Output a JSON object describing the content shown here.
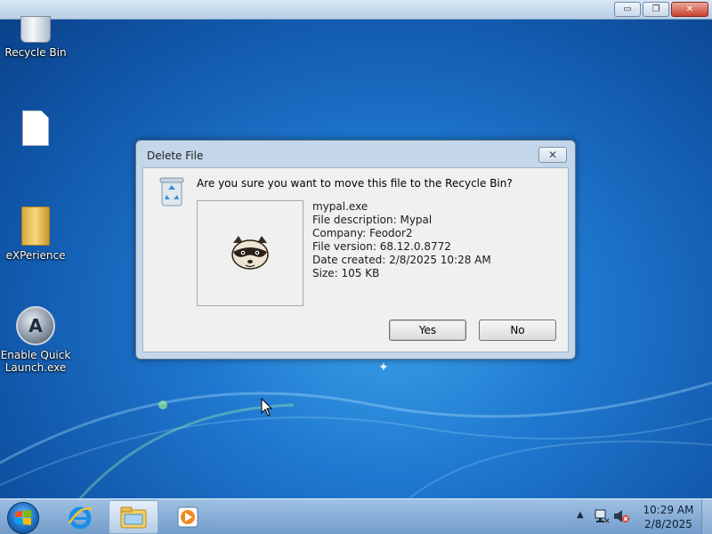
{
  "window_controls": {
    "minimize": "▭",
    "restore": "❐",
    "close": "✕"
  },
  "desktop": {
    "icons": [
      {
        "label": "Recycle Bin",
        "icon": "recycle-bin-icon"
      },
      {
        "label": "",
        "icon": "blank-file-icon"
      },
      {
        "label": "eXPerience",
        "icon": "folder-icon"
      },
      {
        "label": "Enable Quick Launch.exe",
        "icon": "quick-launch-icon"
      }
    ]
  },
  "dialog": {
    "title": "Delete File",
    "close_glyph": "✕",
    "question": "Are you sure you want to move this file to the Recycle Bin?",
    "file": {
      "name": "mypal.exe",
      "description": "File description: Mypal",
      "company": "Company: Feodor2",
      "version": "File version: 68.12.0.8772",
      "date_created": "Date created: 2/8/2025 10:28 AM",
      "size": "Size: 105 KB"
    },
    "buttons": {
      "yes": "Yes",
      "no": "No"
    }
  },
  "taskbar": {
    "items": [
      "start-button",
      "internet-explorer-icon",
      "windows-explorer-icon",
      "media-player-icon"
    ],
    "tray": {
      "up_arrow": "▲",
      "time": "10:29 AM",
      "date": "2/8/2025"
    }
  },
  "colors": {
    "dialog_frame": "#c4d7ea",
    "dialog_body": "#f0f0f0",
    "taskbar": "#8fb3d9",
    "desktop": "#1f78cf"
  }
}
